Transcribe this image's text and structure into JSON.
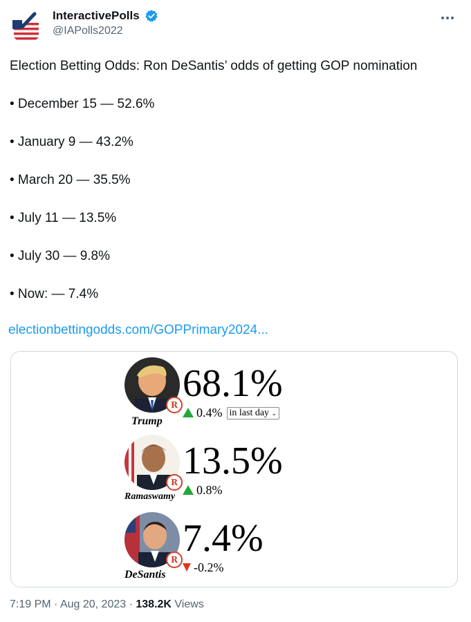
{
  "author": {
    "display_name": "InteractivePolls",
    "handle": "@IAPolls2022",
    "avatar_icon": "us-flag-checkbox-logo",
    "verified_icon": "verified-badge-icon",
    "verified_color": "#1d9bf0"
  },
  "tweet": {
    "headline": "Election Betting Odds: Ron DeSantis’ odds of getting GOP nomination",
    "bullets": [
      "• December 15 — 52.6%",
      "• January 9 — 43.2%",
      "• March 20 — 35.5%",
      "•  July 11 — 13.5%",
      "• July 30 — 9.8%",
      "• Now: — 7.4%"
    ],
    "link_text": "electionbettingodds.com/GOPPrimary2024..."
  },
  "card": {
    "candidates": [
      {
        "name": "Trump",
        "percent": "68.1%",
        "change": "0.4%",
        "direction": "up",
        "party_badge": "R",
        "period_select": "in last day"
      },
      {
        "name": "Ramaswamy",
        "percent": "13.5%",
        "change": "0.8%",
        "direction": "up",
        "party_badge": "R"
      },
      {
        "name": "DeSantis",
        "percent": "7.4%",
        "change": "-0.2%",
        "direction": "down",
        "party_badge": "R"
      }
    ],
    "up_color": "#22a83a",
    "down_color": "#e0341a"
  },
  "meta": {
    "time": "7:19 PM",
    "separator": "·",
    "date": "Aug 20, 2023",
    "views_count": "138.2K",
    "views_label": "Views"
  }
}
